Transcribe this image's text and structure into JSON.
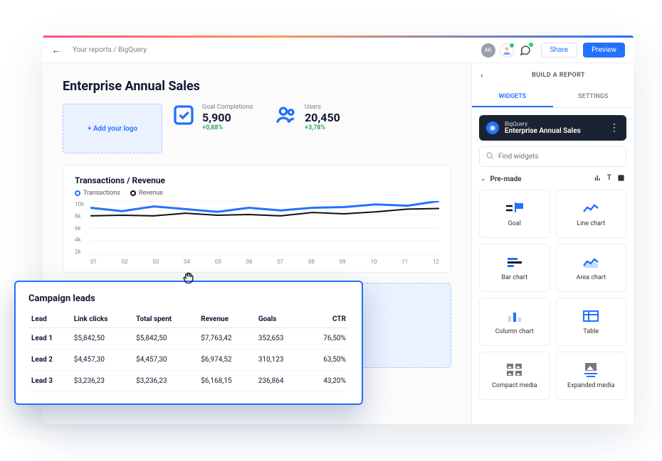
{
  "breadcrumb": "Your reports / BigQuery",
  "buttons": {
    "share": "Share",
    "preview": "Preview"
  },
  "avatars": [
    {
      "initials": "AK",
      "bg": "#9aa0aa"
    },
    {
      "initials": "",
      "bg": "#fff"
    },
    {
      "initials": "",
      "bg": "transparent"
    }
  ],
  "report": {
    "title": "Enterprise Annual Sales",
    "add_logo": "+ Add your logo",
    "kpis": [
      {
        "icon": "check",
        "label": "Goal Completions",
        "value": "5,900",
        "delta": "+0,88%"
      },
      {
        "icon": "users",
        "label": "Users",
        "value": "20,450",
        "delta": "+3,78%"
      }
    ]
  },
  "chart_data": {
    "type": "line",
    "title": "Transactions / Revenue",
    "series": [
      {
        "name": "Transactions",
        "color": "#2371ff",
        "values": [
          9000,
          8500,
          9200,
          8800,
          8400,
          9000,
          8600,
          9000,
          9100,
          9500,
          9300,
          10000
        ]
      },
      {
        "name": "Revenue",
        "color": "#111111",
        "values": [
          7800,
          7900,
          7800,
          8200,
          7900,
          8000,
          7800,
          8300,
          8100,
          8400,
          8800,
          8900
        ]
      }
    ],
    "categories": [
      "01",
      "02",
      "03",
      "04",
      "05",
      "06",
      "07",
      "08",
      "09",
      "10",
      "11",
      "12"
    ],
    "y_ticks": [
      "10k",
      "8k",
      "6k",
      "4k",
      "2k"
    ],
    "ylim": [
      2000,
      10000
    ]
  },
  "table": {
    "title": "Campaign leads",
    "columns": [
      "Lead",
      "Link clicks",
      "Total spent",
      "Revenue",
      "Goals",
      "CTR"
    ],
    "rows": [
      [
        "Lead 1",
        "$5,842,50",
        "$5,842,50",
        "$7,763,42",
        "352,653",
        "76,50%"
      ],
      [
        "Lead 2",
        "$4,457,30",
        "$4,457,30",
        "$6,974,52",
        "310,123",
        "63,50%"
      ],
      [
        "Lead 3",
        "$3,236,23",
        "$3,236,23",
        "$6,168,15",
        "236,864",
        "43,20%"
      ]
    ]
  },
  "sidebar": {
    "title": "BUILD A REPORT",
    "tabs": {
      "widgets": "WIDGETS",
      "settings": "SETTINGS"
    },
    "datasource": {
      "provider": "BigQuery",
      "name": "Enterprise Annual Sales"
    },
    "search_placeholder": "Find widgets",
    "premade_label": "Pre-made",
    "widgets": [
      "Goal",
      "Line chart",
      "Bar chart",
      "Area chart",
      "Column chart",
      "Table",
      "Compact media",
      "Expanded media"
    ]
  }
}
